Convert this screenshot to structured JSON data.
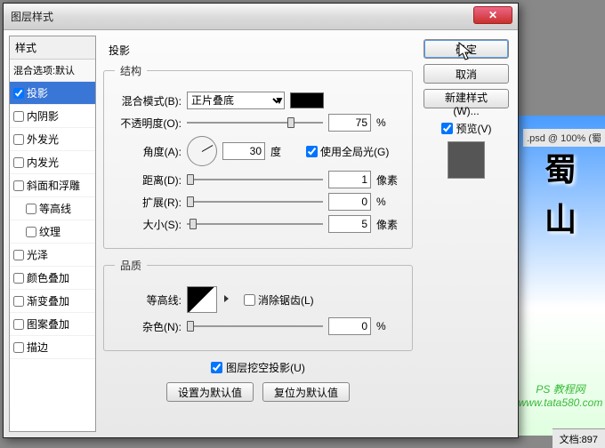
{
  "bg": {
    "char1": "蜀",
    "char2": "山",
    "ps_credit": "PS 教程网",
    "url": "www.tata580.com",
    "doc_title": ".psd @ 100% (蜀"
  },
  "status": {
    "doc": "文档:897"
  },
  "dialog": {
    "title": "图层样式"
  },
  "styles": {
    "header": "样式",
    "sub": "混合选项:默认",
    "items": [
      {
        "label": "投影",
        "checked": true,
        "selected": true
      },
      {
        "label": "内阴影",
        "checked": false
      },
      {
        "label": "外发光",
        "checked": false
      },
      {
        "label": "内发光",
        "checked": false
      },
      {
        "label": "斜面和浮雕",
        "checked": false
      },
      {
        "label": "等高线",
        "checked": false,
        "sub": true
      },
      {
        "label": "纹理",
        "checked": false,
        "sub": true
      },
      {
        "label": "光泽",
        "checked": false
      },
      {
        "label": "颜色叠加",
        "checked": false
      },
      {
        "label": "渐变叠加",
        "checked": false
      },
      {
        "label": "图案叠加",
        "checked": false
      },
      {
        "label": "描边",
        "checked": false
      }
    ]
  },
  "panel": {
    "title": "投影"
  },
  "struct": {
    "legend": "结构",
    "blend_label": "混合模式(B):",
    "blend_value": "正片叠底",
    "opacity_label": "不透明度(O):",
    "opacity_value": "75",
    "pct": "%",
    "angle_label": "角度(A):",
    "angle_value": "30",
    "deg": "度",
    "global_label": "使用全局光(G)",
    "dist_label": "距离(D):",
    "dist_value": "1",
    "px": "像素",
    "spread_label": "扩展(R):",
    "spread_value": "0",
    "size_label": "大小(S):",
    "size_value": "5"
  },
  "quality": {
    "legend": "品质",
    "contour_label": "等高线:",
    "aa_label": "消除锯齿(L)",
    "noise_label": "杂色(N):",
    "noise_value": "0",
    "pct": "%"
  },
  "knockout": {
    "label": "图层挖空投影(U)"
  },
  "buttons": {
    "default": "设置为默认值",
    "reset": "复位为默认值",
    "ok": "确定",
    "cancel": "取消",
    "newstyle": "新建样式(W)...",
    "preview": "预览(V)"
  }
}
